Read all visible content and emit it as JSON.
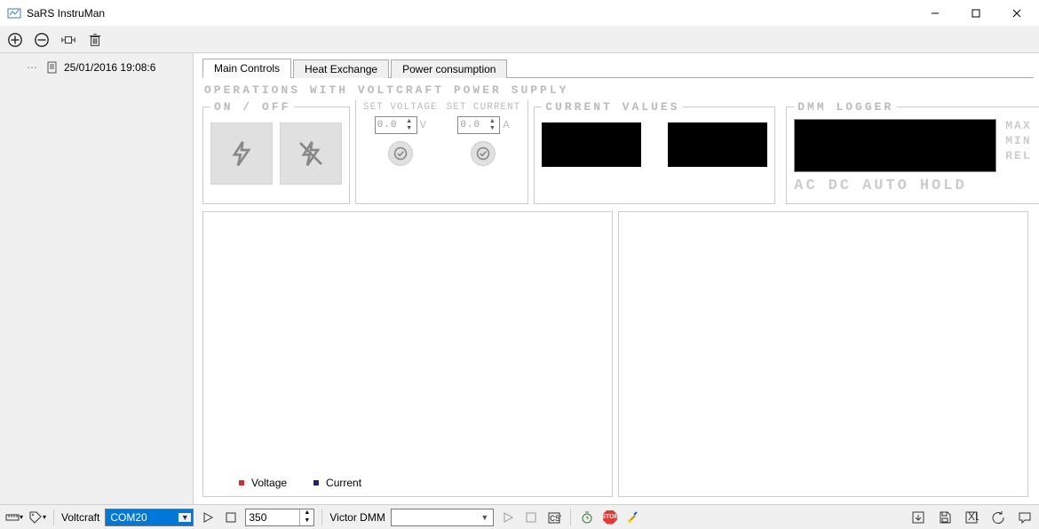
{
  "window": {
    "title": "SaRS InstruMan"
  },
  "tree": {
    "item0": {
      "label": "25/01/2016 19:08:6"
    }
  },
  "tabs": {
    "t0": "Main Controls",
    "t1": "Heat Exchange",
    "t2": "Power consumption"
  },
  "ops": {
    "title": "OPERATIONS WITH VOLTCRAFT POWER SUPPLY",
    "onoff": "ON / OFF",
    "setv": "SET VOLTAGE",
    "setc": "SET CURRENT",
    "vval": "0.0",
    "cval": "0.0",
    "vunit": "V",
    "cunit": "A"
  },
  "curvals": {
    "title": "CURRENT VALUES"
  },
  "dmm": {
    "title": "DMM LOGGER",
    "max": "MAX",
    "min": "MIN",
    "rel": "REL",
    "ac": "AC",
    "dc": "DC",
    "auto": "AUTO",
    "hold": "HOLD"
  },
  "chart_legend": {
    "voltage": "Voltage",
    "current": "Current"
  },
  "status": {
    "voltcraft_label": "Voltcraft",
    "voltcraft_port": "COM20",
    "interval": "350",
    "victor_label": "Victor DMM",
    "victor_port": ""
  }
}
